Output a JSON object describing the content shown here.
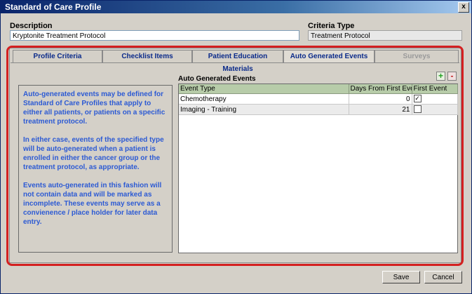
{
  "window": {
    "title": "Standard of Care Profile",
    "close_label": "x"
  },
  "form": {
    "description_label": "Description",
    "description_value": "Kryptonite Treatment Protocol",
    "criteria_type_label": "Criteria Type",
    "criteria_type_value": "Treatment Protocol"
  },
  "tabs": [
    {
      "label": "Profile Criteria",
      "state": "normal"
    },
    {
      "label": "Checklist Items",
      "state": "normal"
    },
    {
      "label": "Patient Education Materials",
      "state": "normal"
    },
    {
      "label": "Auto Generated Events",
      "state": "active"
    },
    {
      "label": "Surveys",
      "state": "disabled"
    }
  ],
  "info_text": [
    "Auto-generated events may be defined for Standard of Care Profiles that apply to either all patients, or patients on a specific treatment protocol.",
    "In either case, events of the specified type will be auto-generated when a patient is enrolled in either the cancer group or the treatment protocol, as appropriate.",
    "Events auto-generated in this fashion will not contain data and will be marked as incomplete. These events may serve as a convienence / place holder for later data entry."
  ],
  "events_grid": {
    "title": "Auto Generated Events",
    "add_label": "+",
    "remove_label": "-",
    "columns": [
      "Event Type",
      "Days From First Even",
      "First Event"
    ],
    "rows": [
      {
        "event_type": "Chemotherapy",
        "days": "0",
        "first_event": true
      },
      {
        "event_type": "Imaging - Training",
        "days": "21",
        "first_event": false
      }
    ]
  },
  "buttons": {
    "save": "Save",
    "cancel": "Cancel"
  },
  "colors": {
    "accent_frame": "#d42020",
    "info_text": "#2c5ad4",
    "grid_header": "#b7cca9",
    "titlebar": "#0a246a"
  }
}
